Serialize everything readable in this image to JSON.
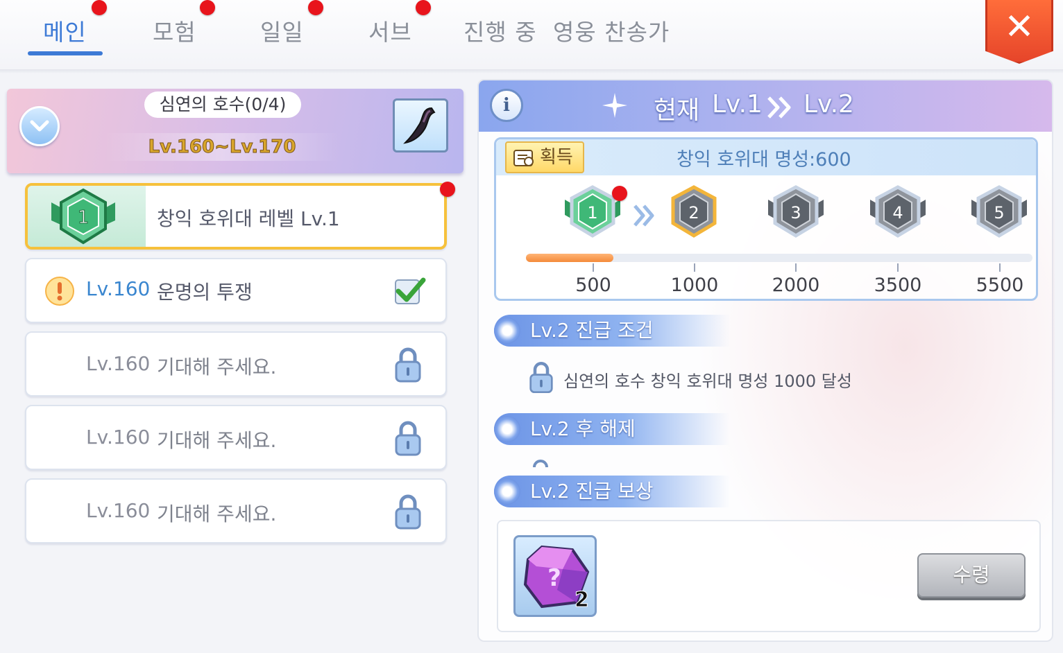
{
  "tabs": [
    {
      "label": "메인",
      "active": true,
      "badge": true
    },
    {
      "label": "모험",
      "active": false,
      "badge": true
    },
    {
      "label": "일일",
      "active": false,
      "badge": true
    },
    {
      "label": "서브",
      "active": false,
      "badge": true
    },
    {
      "label": "진행 중",
      "active": false,
      "badge": false
    },
    {
      "label": "영웅 찬송가",
      "active": false,
      "badge": false
    }
  ],
  "close_label": "✕",
  "area": {
    "title": "심연의 호수(0/4)",
    "level_range": "Lv.160~Lv.170"
  },
  "quests": [
    {
      "level": "",
      "name": "창익 호위대 레벨 Lv.1",
      "badge_num": "1",
      "status": "selected"
    },
    {
      "level": "Lv.160",
      "name": "운명의 투쟁",
      "status": "complete"
    },
    {
      "level": "Lv.160",
      "name": "기대해 주세요.",
      "status": "locked"
    },
    {
      "level": "Lv.160",
      "name": "기대해 주세요.",
      "status": "locked"
    },
    {
      "level": "Lv.160",
      "name": "기대해 주세요.",
      "status": "locked"
    }
  ],
  "header": {
    "info_label": "i",
    "current_label": "현재",
    "from_level": "Lv.1",
    "to_level": "Lv.2"
  },
  "fame": {
    "gain_label": "획득",
    "text": "창익 호위대 명성:600",
    "progress": 0.09,
    "milestones": [
      {
        "num": "1",
        "value": "500"
      },
      {
        "num": "2",
        "value": "1000"
      },
      {
        "num": "3",
        "value": "2000"
      },
      {
        "num": "4",
        "value": "3500"
      },
      {
        "num": "5",
        "value": "5500"
      }
    ]
  },
  "sections": {
    "condition_title": "Lv.2 진급 조건",
    "condition_text": "심연의 호수 창익 호위대 명성 1000 달성",
    "unlock_title": "Lv.2 후 해제",
    "reward_title": "Lv.2 진급 보상"
  },
  "reward": {
    "quantity": "2",
    "claim_label": "수령"
  },
  "colors": {
    "accent": "#3d7ad6",
    "badge_red": "#e8141c",
    "selected_border": "#f6c13c",
    "progress": "#f48a3a"
  }
}
